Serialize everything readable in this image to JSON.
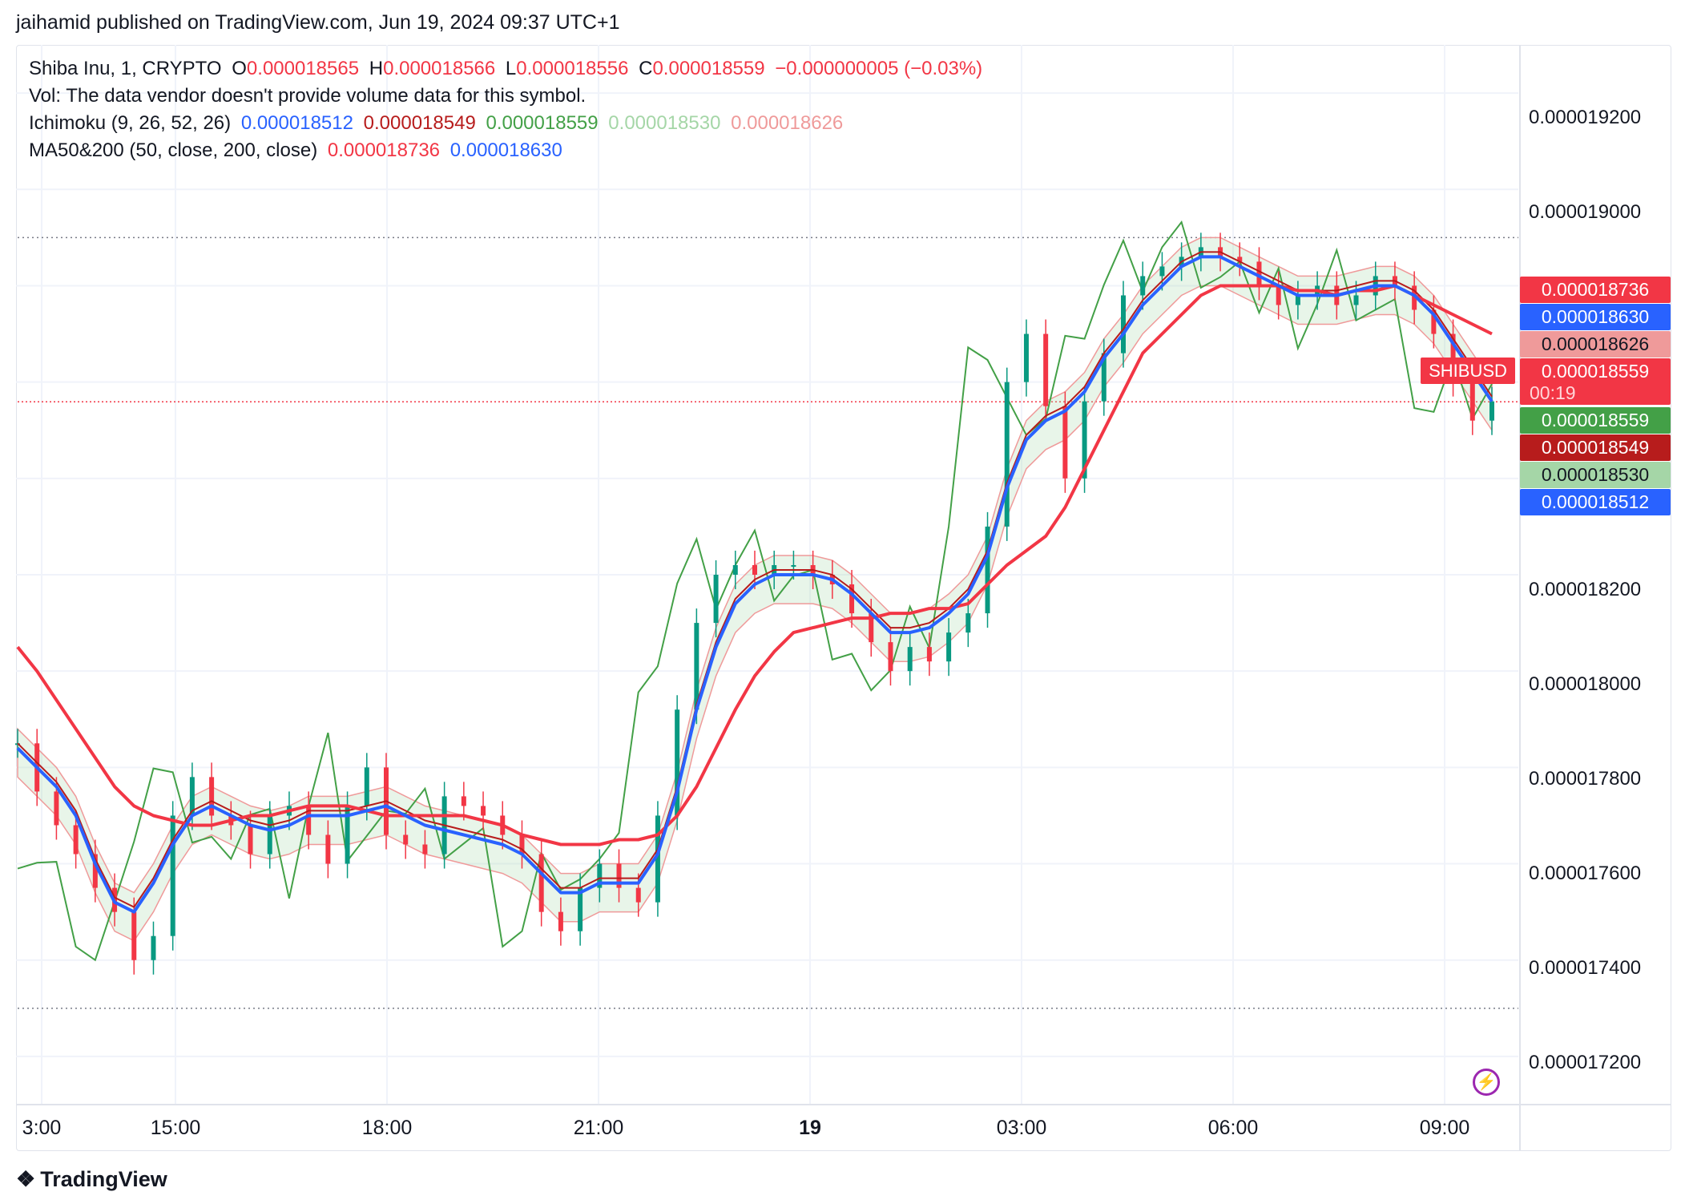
{
  "header": {
    "publisher": "jaihamid published on TradingView.com, Jun 19, 2024 09:37 UTC+1"
  },
  "legend": {
    "symbol": "Shiba Inu, 1, CRYPTO",
    "open_label": "O",
    "open": "0.000018565",
    "high_label": "H",
    "high": "0.000018566",
    "low_label": "L",
    "low": "0.000018556",
    "close_label": "C",
    "close": "0.000018559",
    "change": "−0.000000005 (−0.03%)",
    "vol": "Vol: The data vendor doesn't provide volume data for this symbol.",
    "ichimoku_label": "Ichimoku (9, 26, 52, 26)",
    "ichimoku_values": [
      "0.000018512",
      "0.000018549",
      "0.000018559",
      "0.000018530",
      "0.000018626"
    ],
    "ma_label": "MA50&200 (50, close, 200, close)",
    "ma_values": [
      "0.000018736",
      "0.000018630"
    ]
  },
  "badges": {
    "ma200": "0.000018736",
    "ma50": "0.000018630",
    "senkou_b": "0.000018626",
    "last": "0.000018559",
    "countdown": "00:19",
    "lagging": "0.000018559",
    "base": "0.000018549",
    "senkou_a": "0.000018530",
    "conversion": "0.000018512",
    "symbol_tag": "SHIBUSD"
  },
  "colors": {
    "up": "#089981",
    "down": "#f23645",
    "ma200": "#f23645",
    "ma50": "#2962ff",
    "conversion": "#2962ff",
    "base": "#b71c1c",
    "lagging": "#43a047",
    "cloud_green": "#a5d6a7",
    "cloud_red": "#ef9a9a"
  },
  "footer": {
    "logo_text": "TradingView",
    "logo_icon": "tradingview-logo-icon"
  },
  "chart_data": {
    "type": "line",
    "x_labels": [
      "3:00",
      "15:00",
      "18:00",
      "21:00",
      "19",
      "03:00",
      "06:00",
      "09:00"
    ],
    "y_ticks": [
      "0.000019200",
      "0.000019000",
      "0.000018200",
      "0.000018000",
      "0.000017800",
      "0.000017600",
      "0.000017400",
      "0.000017200"
    ],
    "ylim": [
      1.71e-05,
      1.93e-05
    ],
    "series": [
      {
        "key": "close",
        "color": "#131722",
        "values": [
          17.85,
          17.75,
          17.68,
          17.62,
          17.55,
          17.5,
          17.4,
          17.45,
          17.7,
          17.78,
          17.7,
          17.68,
          17.62,
          17.7,
          17.72,
          17.66,
          17.6,
          17.72,
          17.8,
          17.66,
          17.64,
          17.62,
          17.74,
          17.72,
          17.7,
          17.66,
          17.62,
          17.5,
          17.46,
          17.55,
          17.6,
          17.55,
          17.52,
          17.7,
          17.92,
          18.1,
          18.2,
          18.22,
          18.2,
          18.22,
          18.22,
          18.2,
          18.18,
          18.12,
          18.06,
          18.0,
          18.05,
          18.02,
          18.08,
          18.12,
          18.3,
          18.6,
          18.7,
          18.55,
          18.4,
          18.56,
          18.66,
          18.78,
          18.82,
          18.84,
          18.86,
          18.88,
          18.86,
          18.85,
          18.8,
          18.76,
          18.78,
          18.8,
          18.76,
          18.78,
          18.82,
          18.8,
          18.75,
          18.7,
          18.6,
          18.52,
          18.56
        ]
      },
      {
        "key": "ma200",
        "name": "MA200",
        "color": "#f23645",
        "values": [
          18.05,
          18.0,
          17.94,
          17.88,
          17.82,
          17.76,
          17.72,
          17.7,
          17.69,
          17.68,
          17.68,
          17.69,
          17.7,
          17.7,
          17.71,
          17.72,
          17.72,
          17.72,
          17.71,
          17.7,
          17.7,
          17.7,
          17.7,
          17.7,
          17.69,
          17.68,
          17.66,
          17.65,
          17.64,
          17.64,
          17.64,
          17.65,
          17.65,
          17.66,
          17.7,
          17.76,
          17.84,
          17.92,
          17.99,
          18.04,
          18.08,
          18.09,
          18.1,
          18.11,
          18.11,
          18.12,
          18.12,
          18.13,
          18.13,
          18.14,
          18.18,
          18.22,
          18.25,
          18.28,
          18.34,
          18.42,
          18.5,
          18.58,
          18.66,
          18.7,
          18.74,
          18.78,
          18.8,
          18.8,
          18.8,
          18.8,
          18.79,
          18.79,
          18.78,
          18.79,
          18.79,
          18.8,
          18.78,
          18.76,
          18.74,
          18.72,
          18.7
        ]
      },
      {
        "key": "ma50",
        "name": "MA50",
        "color": "#2962ff",
        "values": [
          17.84,
          17.8,
          17.76,
          17.7,
          17.6,
          17.52,
          17.5,
          17.56,
          17.64,
          17.7,
          17.72,
          17.7,
          17.68,
          17.67,
          17.68,
          17.7,
          17.7,
          17.7,
          17.71,
          17.72,
          17.7,
          17.68,
          17.67,
          17.66,
          17.65,
          17.64,
          17.62,
          17.58,
          17.54,
          17.54,
          17.56,
          17.56,
          17.56,
          17.62,
          17.75,
          17.92,
          18.05,
          18.14,
          18.18,
          18.2,
          18.2,
          18.2,
          18.19,
          18.16,
          18.12,
          18.08,
          18.08,
          18.09,
          18.12,
          18.16,
          18.24,
          18.38,
          18.48,
          18.52,
          18.54,
          18.58,
          18.65,
          18.7,
          18.76,
          18.8,
          18.84,
          18.86,
          18.86,
          18.84,
          18.82,
          18.8,
          18.78,
          18.78,
          18.78,
          18.79,
          18.8,
          18.8,
          18.78,
          18.74,
          18.68,
          18.62,
          18.56
        ]
      }
    ],
    "grid": true
  }
}
